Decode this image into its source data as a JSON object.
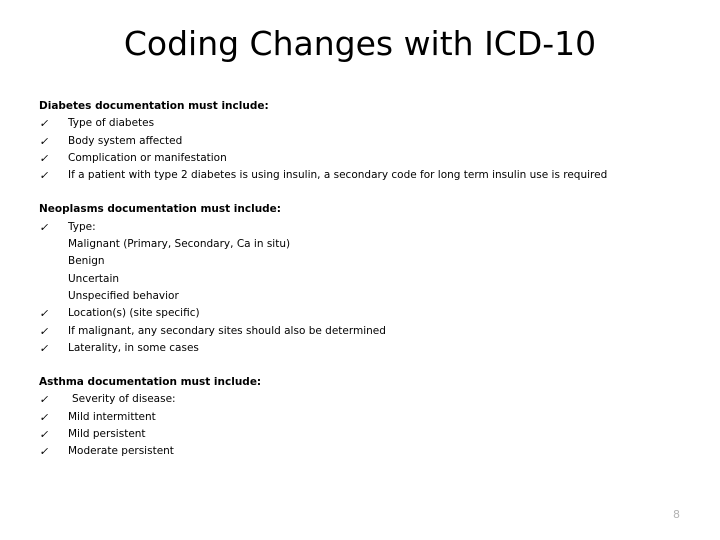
{
  "slide": {
    "title": "Coding Changes with ICD-10",
    "page_number": "8",
    "check_glyph": "✓",
    "text_color": "#000000",
    "page_number_color": "#B3B3B3",
    "background_color": "#FFFFFF"
  },
  "sections": [
    {
      "heading": "Diabetes documentation must include:",
      "items": [
        {
          "text": "Type of diabetes",
          "sublines": []
        },
        {
          "text": "Body system affected",
          "sublines": []
        },
        {
          "text": "Complication or manifestation",
          "sublines": []
        },
        {
          "text": "If a patient with type 2 diabetes is using insulin, a secondary code for long term insulin use is required",
          "sublines": []
        }
      ]
    },
    {
      "heading": "Neoplasms documentation must include:",
      "items": [
        {
          "text": "Type:",
          "sublines": [
            "Malignant (Primary, Secondary, Ca in situ)",
            "Benign",
            "Uncertain",
            "Unspecified behavior"
          ]
        },
        {
          "text": "Location(s) (site specific)",
          "sublines": []
        },
        {
          "text": "If malignant, any secondary sites should also be determined",
          "sublines": []
        },
        {
          "text": "Laterality, in some cases",
          "sublines": []
        }
      ]
    },
    {
      "heading": "Asthma documentation must include:",
      "items": [
        {
          "text": "Severity of disease:",
          "sublines": [],
          "extra_indent": true
        },
        {
          "text": "Mild intermittent",
          "sublines": []
        },
        {
          "text": "Mild persistent",
          "sublines": []
        },
        {
          "text": "Moderate persistent",
          "sublines": []
        }
      ]
    }
  ]
}
